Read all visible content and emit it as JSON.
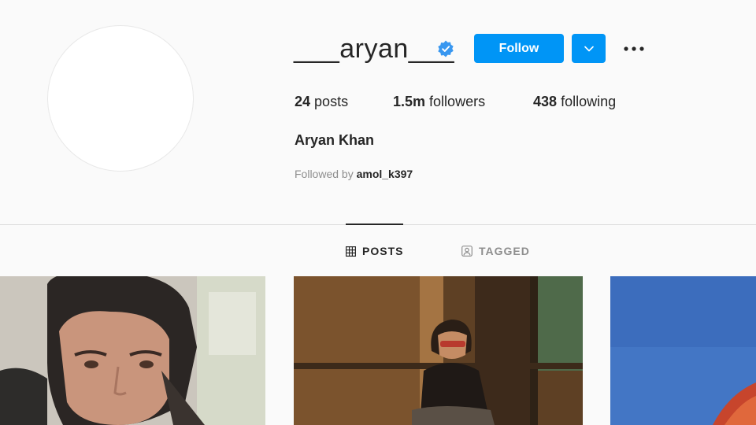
{
  "profile": {
    "username": "___aryan___",
    "follow_label": "Follow",
    "full_name": "Aryan Khan",
    "followed_by_prefix": "Followed by",
    "followed_by_user": "amol_k397"
  },
  "stats": {
    "posts_count": "24",
    "posts_label": "posts",
    "followers_count": "1.5m",
    "followers_label": "followers",
    "following_count": "438",
    "following_label": "following"
  },
  "tabs": [
    {
      "label": "POSTS",
      "icon": "grid-icon",
      "active": true
    },
    {
      "label": "TAGGED",
      "icon": "tagged-icon",
      "active": false
    }
  ],
  "icons": {
    "verified": "verified-badge-icon",
    "dropdown": "chevron-down-icon",
    "more": "more-options-icon"
  },
  "colors": {
    "accent": "#0095f6",
    "text": "#262626",
    "muted": "#8e8e8e",
    "verified": "#3897f0"
  }
}
